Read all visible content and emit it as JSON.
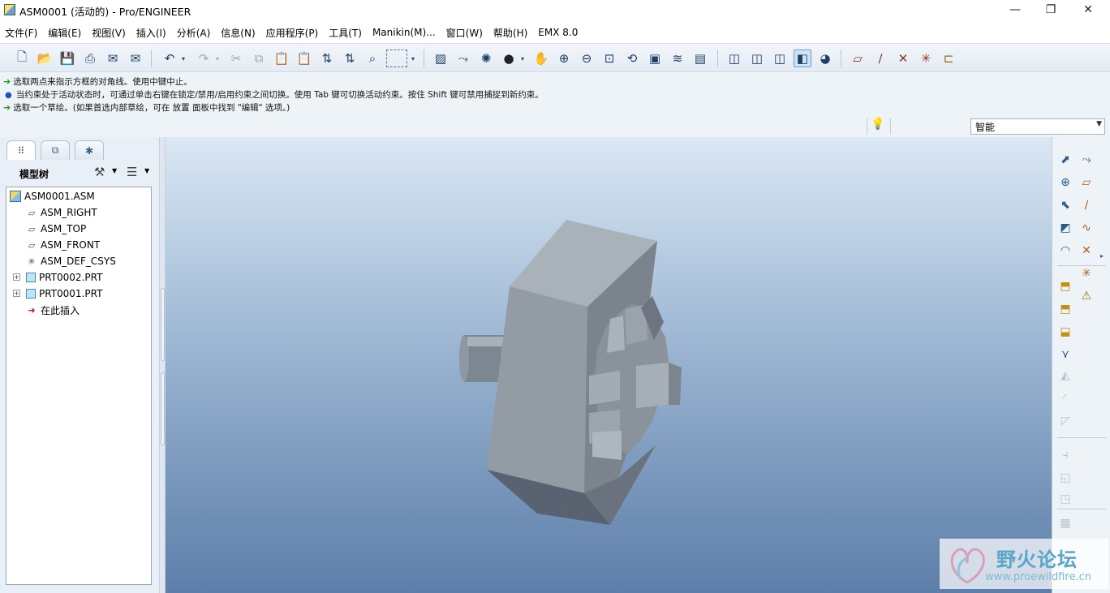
{
  "window": {
    "title": "ASM0001 (活动的) - Pro/ENGINEER",
    "minimize_glyph": "—",
    "restore_glyph": "❐",
    "close_glyph": "✕"
  },
  "menu": [
    "文件(F)",
    "编辑(E)",
    "视图(V)",
    "插入(I)",
    "分析(A)",
    "信息(N)",
    "应用程序(P)",
    "工具(T)",
    "Manikin(M)...",
    "窗口(W)",
    "帮助(H)",
    "EMX 8.0"
  ],
  "messages": [
    {
      "type": "prompt",
      "text": "选取两点来指示方框的对角线。使用中键中止。"
    },
    {
      "type": "info",
      "text": "当约束处于活动状态时，可通过单击右键在锁定/禁用/启用约束之间切换。使用 Tab 键可切换活动约束。按住 Shift 键可禁用捕捉到新约束。"
    },
    {
      "type": "prompt",
      "text": "选取一个草绘。(如果首选内部草绘，可在 放置 面板中找到 \"编辑\" 选项。)"
    }
  ],
  "filter": {
    "value": "智能"
  },
  "left_panel": {
    "tree_label": "模型树",
    "nodes": [
      {
        "label": "ASM0001.ASM",
        "icon": "assembly-icon"
      },
      {
        "label": "ASM_RIGHT",
        "icon": "datum-plane-icon"
      },
      {
        "label": "ASM_TOP",
        "icon": "datum-plane-icon"
      },
      {
        "label": "ASM_FRONT",
        "icon": "datum-plane-icon"
      },
      {
        "label": "ASM_DEF_CSYS",
        "icon": "csys-icon"
      },
      {
        "label": "PRT0002.PRT",
        "icon": "part-icon"
      },
      {
        "label": "PRT0001.PRT",
        "icon": "part-icon"
      },
      {
        "label": "在此插入",
        "icon": "insert-here-icon"
      }
    ]
  },
  "watermark": {
    "name": "野火论坛",
    "url": "www.proewildfire.cn"
  },
  "colors": {
    "bg_top": "#dbe8f4",
    "bg_bottom": "#5d7ea9",
    "part": "#9aa3ad"
  }
}
